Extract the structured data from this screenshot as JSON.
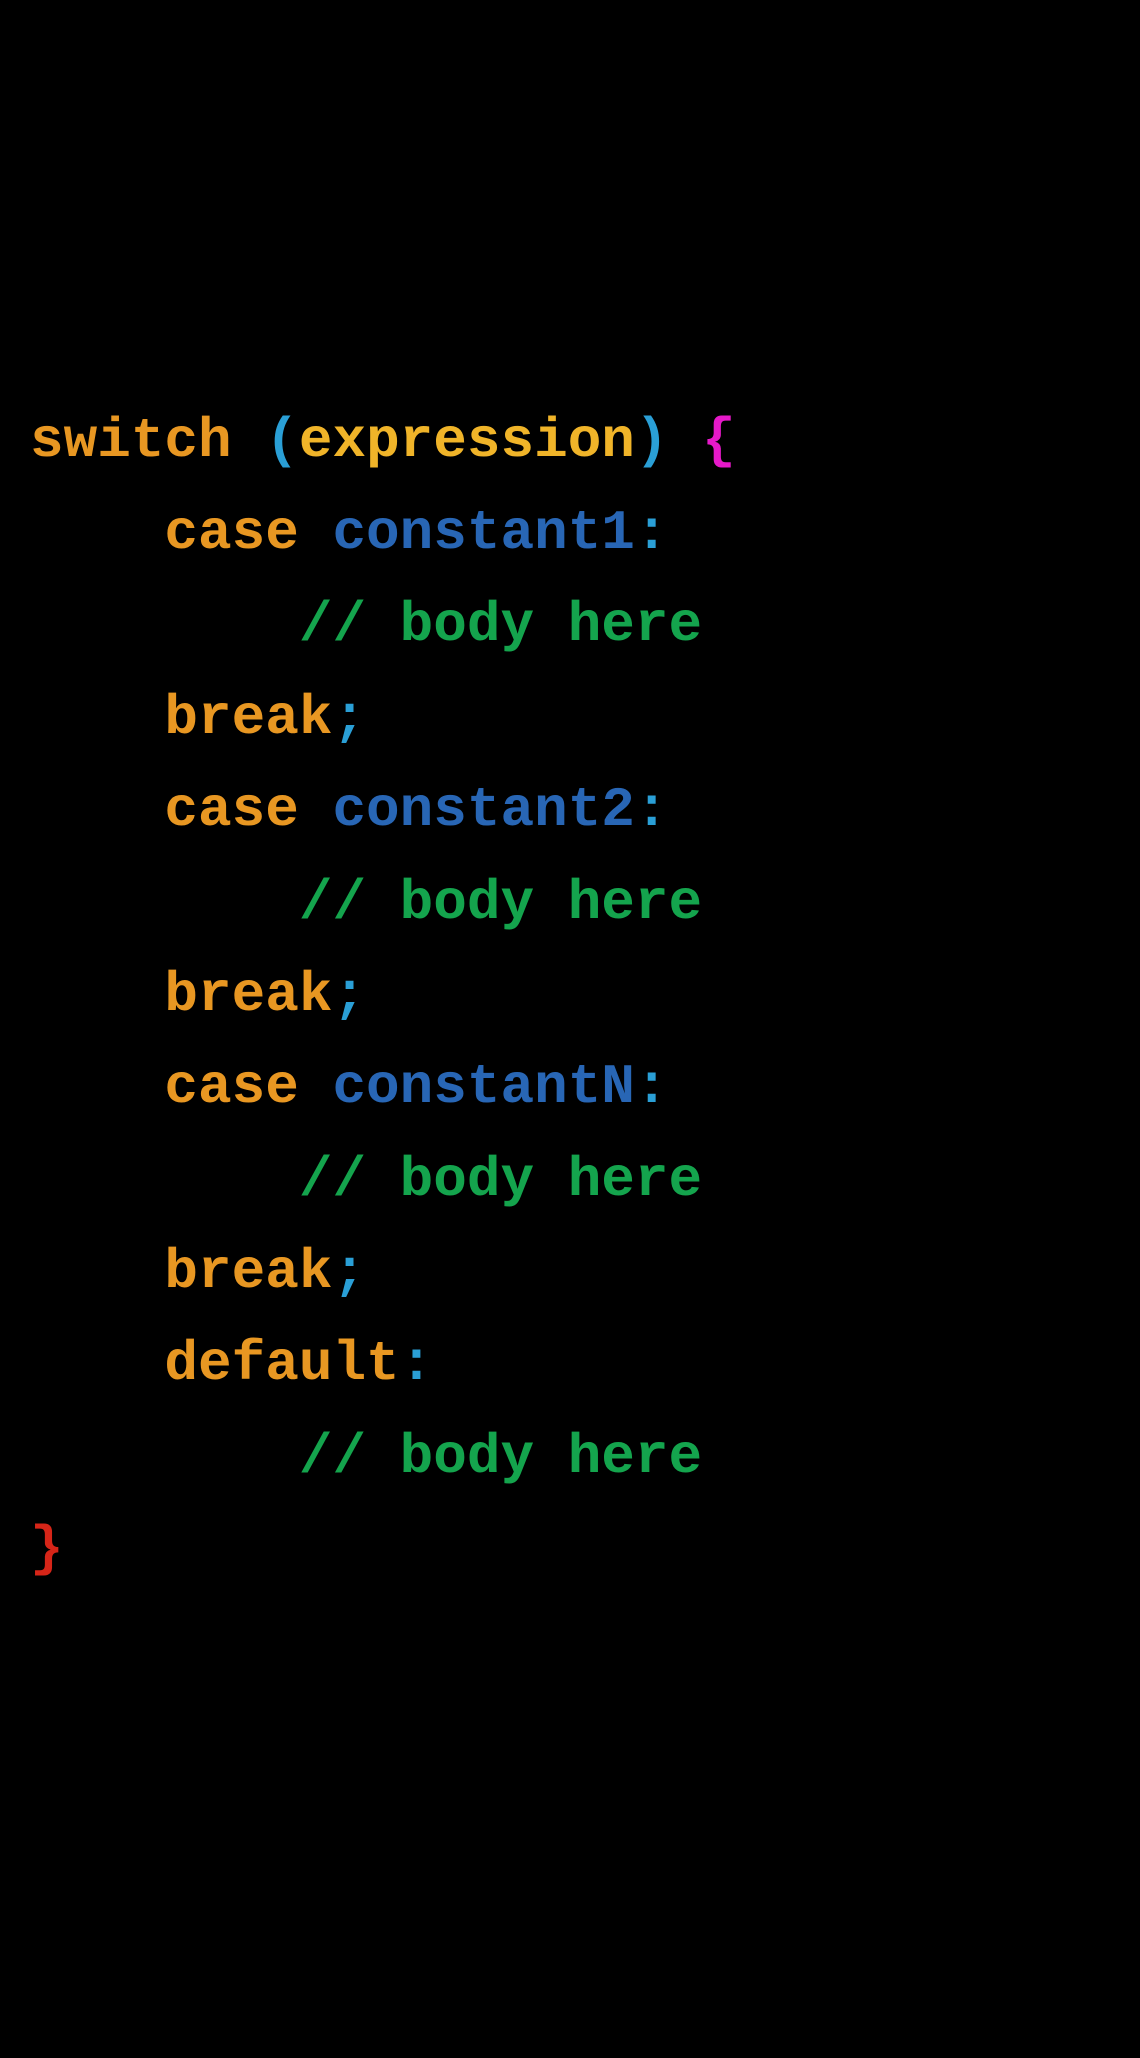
{
  "code": {
    "line1": {
      "switch": "switch",
      "space1": " ",
      "lparen": "(",
      "expression": "expression",
      "rparen": ")",
      "space2": " ",
      "lbrace": "{"
    },
    "line2": {
      "indent": "    ",
      "case": "case",
      "space": " ",
      "constant": "constant",
      "num": "1",
      "colon": ":"
    },
    "line3": {
      "indent": "        ",
      "comment": "// body here"
    },
    "line4": {
      "indent": "    ",
      "break": "break",
      "semi": ";"
    },
    "line5": {
      "indent": "    ",
      "case": "case",
      "space": " ",
      "constant": "constant",
      "num": "2",
      "colon": ":"
    },
    "line6": {
      "indent": "        ",
      "comment": "// body here"
    },
    "line7": {
      "indent": "    ",
      "break": "break",
      "semi": ";"
    },
    "line8": {
      "indent": "    ",
      "case": "case",
      "space": " ",
      "constant": "constant",
      "num": "N",
      "colon": ":"
    },
    "line9": {
      "indent": "        ",
      "comment": "// body here"
    },
    "line10": {
      "indent": "    ",
      "break": "break",
      "semi": ";"
    },
    "line11": {
      "indent": "    ",
      "default": "default",
      "colon": ":"
    },
    "line12": {
      "indent": "        ",
      "comment": "// body here"
    },
    "line13": {
      "rbrace": "}"
    }
  }
}
